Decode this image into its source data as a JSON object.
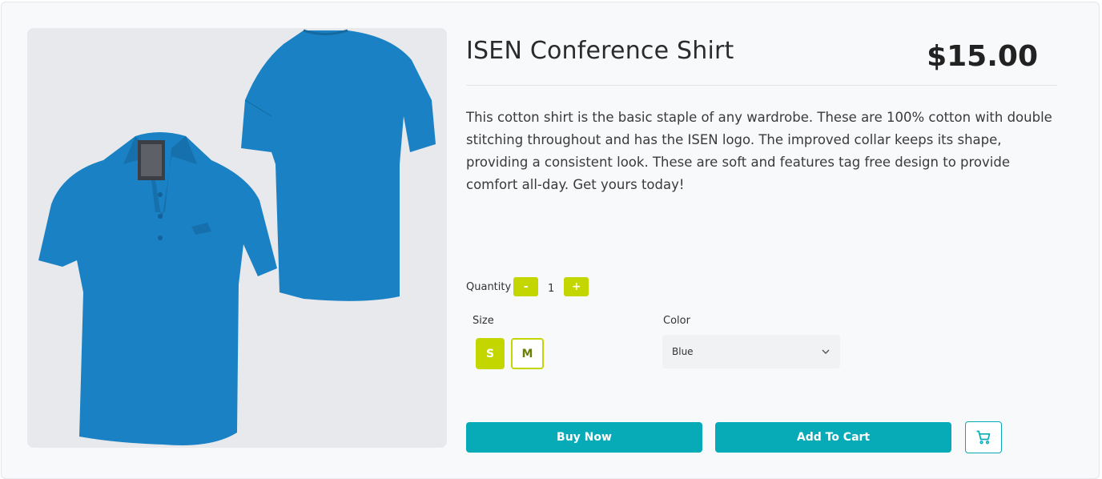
{
  "product": {
    "title": "ISEN Conference Shirt",
    "price": "$15.00",
    "description": "This cotton shirt is the basic staple of any wardrobe. These are 100% cotton with double stitching throughout and has the ISEN logo. The improved collar keeps its shape, providing a consistent look. These are soft and features tag free design to provide comfort all-day. Get yours today!"
  },
  "quantity": {
    "label": "Quantity",
    "minus": "-",
    "plus": "+",
    "value": "1"
  },
  "size": {
    "label": "Size",
    "options": [
      "S",
      "M"
    ],
    "selected": "S"
  },
  "color": {
    "label": "Color",
    "selected": "Blue"
  },
  "actions": {
    "buy_now": "Buy Now",
    "add_to_cart": "Add To Cart",
    "cart_icon": "cart-icon"
  },
  "colors": {
    "accent_lime": "#c3d600",
    "accent_teal": "#07aab7",
    "shirt_blue": "#1a82c4"
  }
}
